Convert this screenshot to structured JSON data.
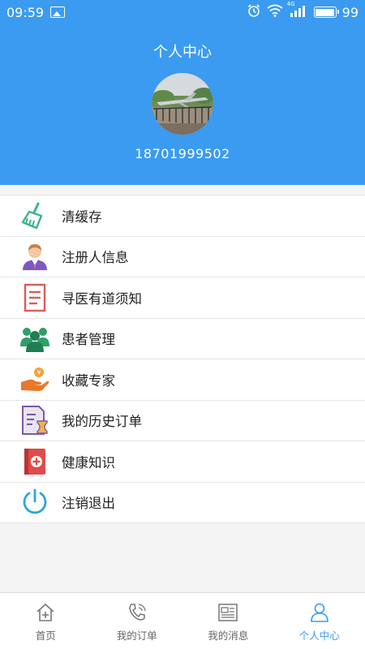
{
  "status": {
    "time": "09:59",
    "network": "4G",
    "battery": "99"
  },
  "header": {
    "title": "个人中心",
    "phone": "18701999502"
  },
  "menu": [
    {
      "label": "清缓存",
      "icon": "broom-icon"
    },
    {
      "label": "注册人信息",
      "icon": "person-icon"
    },
    {
      "label": "寻医有道须知",
      "icon": "document-icon"
    },
    {
      "label": "患者管理",
      "icon": "group-icon"
    },
    {
      "label": "收藏专家",
      "icon": "hand-coin-icon"
    },
    {
      "label": "我的历史订单",
      "icon": "order-history-icon"
    },
    {
      "label": "健康知识",
      "icon": "medical-book-icon"
    },
    {
      "label": "注销退出",
      "icon": "power-icon"
    }
  ],
  "tabs": [
    {
      "label": "首页",
      "icon": "home-icon"
    },
    {
      "label": "我的订单",
      "icon": "phone-icon"
    },
    {
      "label": "我的消息",
      "icon": "news-icon"
    },
    {
      "label": "个人中心",
      "icon": "user-icon"
    }
  ],
  "colors": {
    "primary": "#3a9bf0",
    "background": "#f4f4f4"
  }
}
